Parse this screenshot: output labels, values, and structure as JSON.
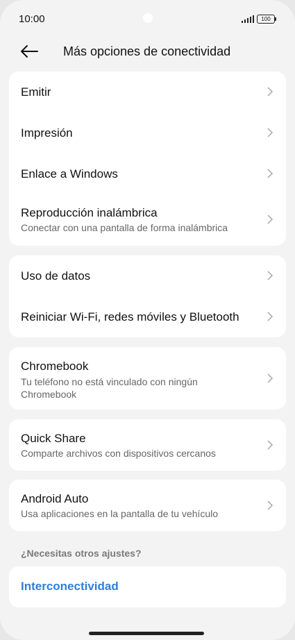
{
  "status": {
    "time": "10:00",
    "battery": "100"
  },
  "header": {
    "title": "Más opciones de conectividad"
  },
  "group1": [
    {
      "label": "Emitir"
    },
    {
      "label": "Impresión"
    },
    {
      "label": "Enlace a Windows"
    },
    {
      "label": "Reproducción inalámbrica",
      "sub": "Conectar con una pantalla de forma inalámbrica"
    }
  ],
  "group2": [
    {
      "label": "Uso de datos"
    },
    {
      "label": "Reiniciar Wi-Fi, redes móviles y Bluetooth"
    }
  ],
  "chromebook": {
    "label": "Chromebook",
    "sub_line1": "Tu teléfono no está vinculado con ningún",
    "sub_line2": "Chromebook"
  },
  "quick_share": {
    "label": "Quick Share",
    "sub": "Comparte archivos con dispositivos cercanos"
  },
  "android_auto": {
    "label": "Android Auto",
    "sub": "Usa aplicaciones en la pantalla de tu vehículo"
  },
  "more": {
    "question": "¿Necesitas otros ajustes?",
    "link": "Interconectividad"
  },
  "colors": {
    "accent": "#2f7ed8",
    "background": "#f3f3f3",
    "card": "#ffffff"
  }
}
